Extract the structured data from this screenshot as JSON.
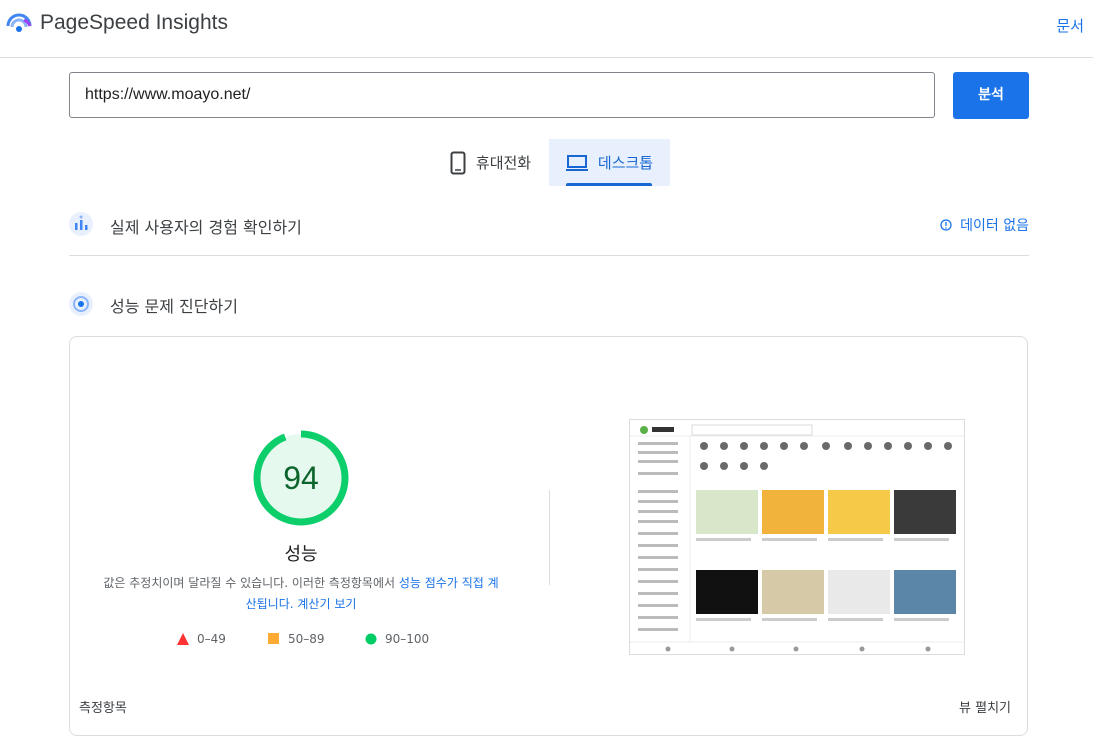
{
  "header": {
    "title": "PageSpeed Insights",
    "docs_link": "문서"
  },
  "search": {
    "url_value": "https://www.moayo.net/",
    "analyze_label": "분석"
  },
  "tabs": [
    {
      "label": "휴대전화",
      "icon": "smartphone-icon",
      "selected": false
    },
    {
      "label": "데스크톱",
      "icon": "laptop-icon",
      "selected": true
    }
  ],
  "field_data": {
    "title": "실제 사용자의 경험 확인하기",
    "status": "데이터 없음"
  },
  "lab": {
    "title": "성능 문제 진단하기",
    "score": "94",
    "score_label": "성능",
    "note_prefix": "값은 추정치이며 달라질 수 있습니다. 이러한 측정항목에서 ",
    "note_link": "성능 점수가 직접 계산됩니다.",
    "note_calc": "계산기 보기",
    "legend": [
      {
        "label": "0–49",
        "color": "#f33"
      },
      {
        "label": "50–89",
        "color": "#fa3"
      },
      {
        "label": "90–100",
        "color": "#0c6"
      }
    ],
    "metrics_label": "측정항목",
    "expand_label": "뷰 펼치기"
  },
  "colors": {
    "accent": "#1a73e8",
    "good": "#0cce6b"
  }
}
